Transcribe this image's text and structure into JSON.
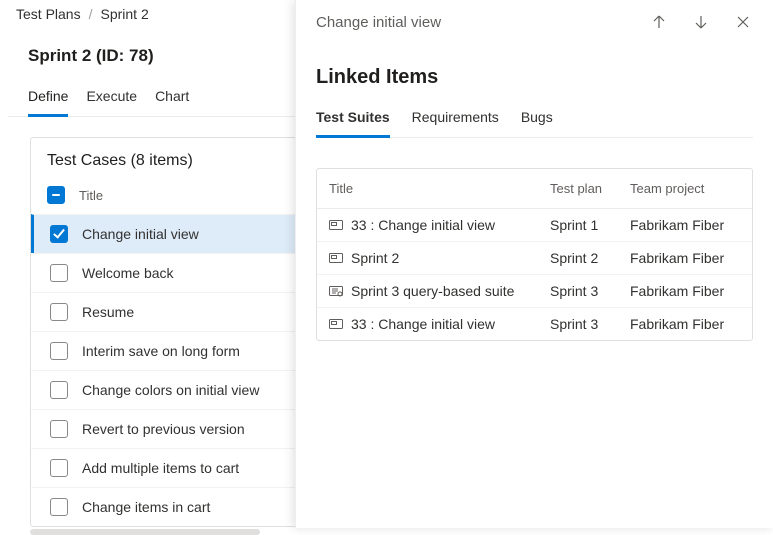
{
  "breadcrumb": {
    "items": [
      "Test Plans",
      "Sprint 2"
    ]
  },
  "page": {
    "title": "Sprint 2 (ID: 78)"
  },
  "main_tabs": {
    "items": [
      "Define",
      "Execute",
      "Chart"
    ],
    "active": 0
  },
  "test_cases": {
    "heading": "Test Cases (8 items)",
    "column_title": "Title",
    "items": [
      {
        "title": "Change initial view",
        "checked": true,
        "selected": true
      },
      {
        "title": "Welcome back",
        "checked": false,
        "selected": false
      },
      {
        "title": "Resume",
        "checked": false,
        "selected": false
      },
      {
        "title": "Interim save on long form",
        "checked": false,
        "selected": false
      },
      {
        "title": "Change colors on initial view",
        "checked": false,
        "selected": false
      },
      {
        "title": "Revert to previous version",
        "checked": false,
        "selected": false
      },
      {
        "title": "Add multiple items to cart",
        "checked": false,
        "selected": false
      },
      {
        "title": "Change items in cart",
        "checked": false,
        "selected": false
      }
    ]
  },
  "panel": {
    "title": "Change initial view",
    "heading": "Linked Items",
    "tabs": [
      "Test Suites",
      "Requirements",
      "Bugs"
    ],
    "active_tab": 0,
    "columns": {
      "title": "Title",
      "plan": "Test plan",
      "project": "Team project"
    },
    "rows": [
      {
        "icon": "static-suite",
        "title": "33 : Change initial view",
        "plan": "Sprint 1",
        "project": "Fabrikam Fiber"
      },
      {
        "icon": "static-suite",
        "title": "Sprint 2",
        "plan": "Sprint 2",
        "project": "Fabrikam Fiber"
      },
      {
        "icon": "query-suite",
        "title": "Sprint 3 query-based suite",
        "plan": "Sprint 3",
        "project": "Fabrikam Fiber"
      },
      {
        "icon": "static-suite",
        "title": "33 : Change initial view",
        "plan": "Sprint 3",
        "project": "Fabrikam Fiber"
      }
    ]
  }
}
